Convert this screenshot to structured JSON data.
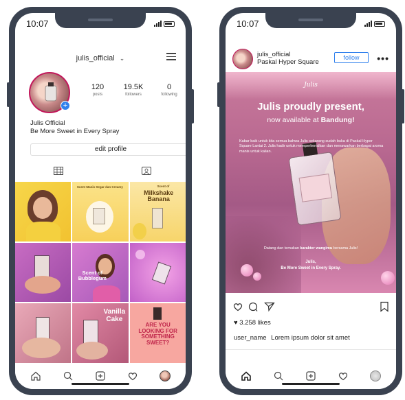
{
  "left": {
    "time": "10:07",
    "username": "julis_official",
    "stats": [
      {
        "value": "120",
        "label": "posts"
      },
      {
        "value": "19.5K",
        "label": "followers"
      },
      {
        "value": "0",
        "label": "following"
      }
    ],
    "bio_name": "Julis Official",
    "bio_text": "Be More Sweet in Every Spray",
    "edit_profile": "edit profile",
    "grid_captions": {
      "c2": "Scent Manis Segar dan Creamy",
      "c3_small": "Scent of",
      "c3": "Milkshake Banana",
      "c5": "Scent of Bubblegum",
      "c8": "Vanilla Cake",
      "c9": "ARE YOU LOOKING FOR SOMETHING SWEET?"
    }
  },
  "right": {
    "time": "10:07",
    "username": "julis_official",
    "location": "Paskal Hyper Square",
    "follow": "follow",
    "brand": "Julis",
    "headline": "Julis proudly present,",
    "subline_pre": "now available at ",
    "subline_city": "Bandung!",
    "body_text": "Kabar baik untuk kita semua bahwa Julis sekarang sudah buka di Paskal Hyper Square Lantai 2. Julis hadir untuk memperkenalkan dan menawarkan berbagai aroma manis untuk kalian.",
    "invite_pre": "Datang dan temukan ",
    "invite_bold": "karakter wangimu",
    "invite_post": " bersama Julis!",
    "sign_1": "Julis,",
    "sign_2": "Be More Sweet in Every Spray.",
    "likes": "3.258 likes",
    "caption_user": "user_name",
    "caption_text": "Lorem ipsum dolor sit amet"
  },
  "colors": {
    "phone_frame": "#3a4250",
    "accent_blue": "#2f80ed",
    "post_pink": "#b86890"
  }
}
